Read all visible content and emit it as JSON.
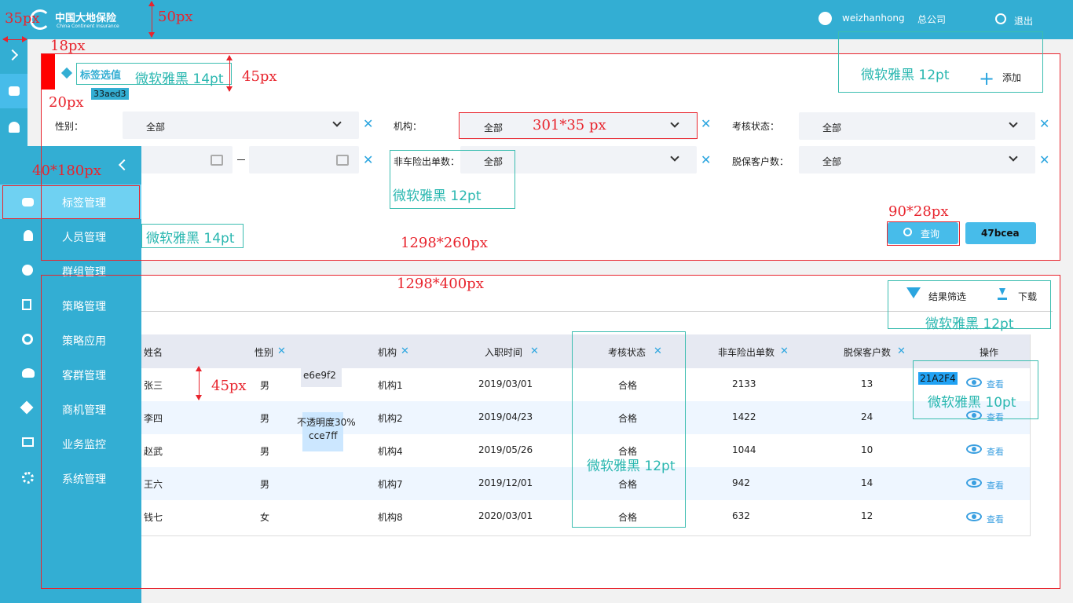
{
  "header": {
    "logo_cn": "中国大地保险",
    "logo_en": "China Continent Insurance",
    "username": "weizhanhong",
    "org": "总公司",
    "logout": "退出"
  },
  "panel1": {
    "title": "标签选值",
    "color_chip": "33aed3",
    "add": "添加",
    "filters": {
      "gender_label": "性别：",
      "gender_value": "全部",
      "org_label": "机构：",
      "org_value": "全部",
      "status_label": "考核状态：",
      "status_value": "全部",
      "noncar_label": "非车险出单数：",
      "noncar_value": "全部",
      "lapse_label": "脱保客户数：",
      "lapse_value": "全部"
    },
    "query": "查询",
    "reset_chip": "47bcea"
  },
  "panel2": {
    "filter_results": "结果筛选",
    "download": "下载",
    "columns": [
      "姓名",
      "性别",
      "机构",
      "入职时间",
      "考核状态",
      "非车险出单数",
      "脱保客户数",
      "操作"
    ],
    "rows": [
      {
        "name": "张三",
        "gender": "男",
        "org": "机构1",
        "date": "2019/03/01",
        "status": "合格",
        "noncar": "2133",
        "lapse": "13",
        "action": "查看"
      },
      {
        "name": "李四",
        "gender": "男",
        "org": "机构2",
        "date": "2019/04/23",
        "status": "合格",
        "noncar": "1422",
        "lapse": "24",
        "action": "查看"
      },
      {
        "name": "赵武",
        "gender": "男",
        "org": "机构4",
        "date": "2019/05/26",
        "status": "合格",
        "noncar": "1044",
        "lapse": "10",
        "action": "查看"
      },
      {
        "name": "王六",
        "gender": "男",
        "org": "机构7",
        "date": "2019/12/01",
        "status": "合格",
        "noncar": "942",
        "lapse": "14",
        "action": "查看"
      },
      {
        "name": "钱七",
        "gender": "女",
        "org": "机构8",
        "date": "2020/03/01",
        "status": "合格",
        "noncar": "632",
        "lapse": "12",
        "action": "查看"
      }
    ],
    "chip_e6": "e6e9f2",
    "chip_opacity": "不透明度30%",
    "chip_cce": "cce7ff",
    "chip_21a": "21A2F4"
  },
  "sidebar": {
    "items": [
      "标签管理",
      "人员管理",
      "群组管理",
      "策略管理",
      "策略应用",
      "客群管理",
      "商机管理",
      "业务监控",
      "系统管理"
    ]
  },
  "annotations": {
    "a35": "35px",
    "a50": "50px",
    "a18": "18px",
    "a20": "20px",
    "a45_title": "45px",
    "a40x180": "40*180px",
    "a301": "301*35 px",
    "a90": "90*28px",
    "a1298_260": "1298*260px",
    "a1298_400": "1298*400px",
    "a45_row": "45px",
    "font14_title": "微软雅黑 14pt",
    "font12_add": "微软雅黑 12pt",
    "font12_noncar": "微软雅黑 12pt",
    "font14_menu": "微软雅黑 14pt",
    "font12_tools": "微软雅黑 12pt",
    "font10_view": "微软雅黑 10pt",
    "font12_status": "微软雅黑 12pt"
  },
  "colors": {
    "primary": "#33aed3",
    "button": "#47bcea",
    "table_header": "#e6e9f2",
    "row_alt": "#eef6ff",
    "link": "#21a2f4",
    "annotation_red": "#e8242d",
    "annotation_teal": "#2ab7b0"
  }
}
